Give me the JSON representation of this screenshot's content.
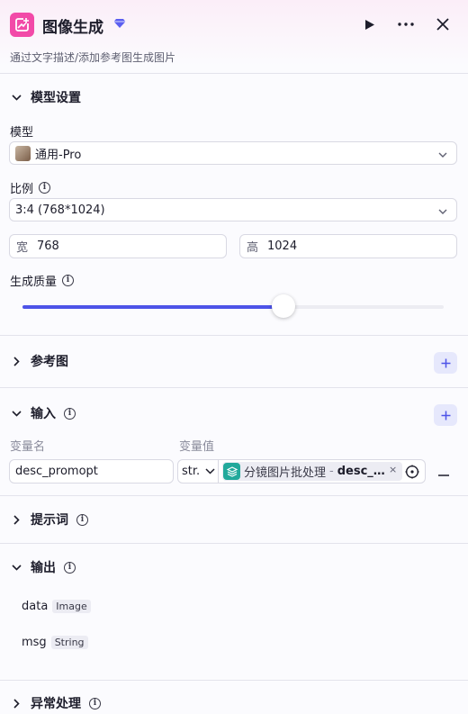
{
  "header": {
    "title": "图像生成",
    "subtitle": "通过文字描述/添加参考图生成图片",
    "icons": {
      "app": "image-generate-icon",
      "badge": "diamond-icon",
      "run": "play-icon",
      "more": "more-icon",
      "close": "close-icon"
    }
  },
  "model_settings": {
    "title": "模型设置",
    "model_label": "模型",
    "model_value": "通用-Pro",
    "ratio_label": "比例",
    "ratio_value": "3:4 (768*1024)",
    "width_prefix": "宽",
    "width_value": "768",
    "height_prefix": "高",
    "height_value": "1024",
    "quality_label": "生成质量",
    "quality_level": 0.62
  },
  "reference": {
    "title": "参考图"
  },
  "input": {
    "title": "输入",
    "col_name": "变量名",
    "col_value": "变量值",
    "row": {
      "name": "desc_promopt",
      "type": "str.",
      "ref_source": "分镜图片批处理",
      "ref_sep": "-",
      "ref_var": "desc_…",
      "ref_close": "×"
    }
  },
  "prompt": {
    "title": "提示词"
  },
  "output": {
    "title": "输出",
    "items": [
      {
        "name": "data",
        "type": "Image"
      },
      {
        "name": "msg",
        "type": "String"
      }
    ]
  },
  "error": {
    "title": "异常处理"
  },
  "colors": {
    "accent": "#4d53e8",
    "app_icon": "#f24aa8",
    "ref_icon": "#22a99b"
  }
}
